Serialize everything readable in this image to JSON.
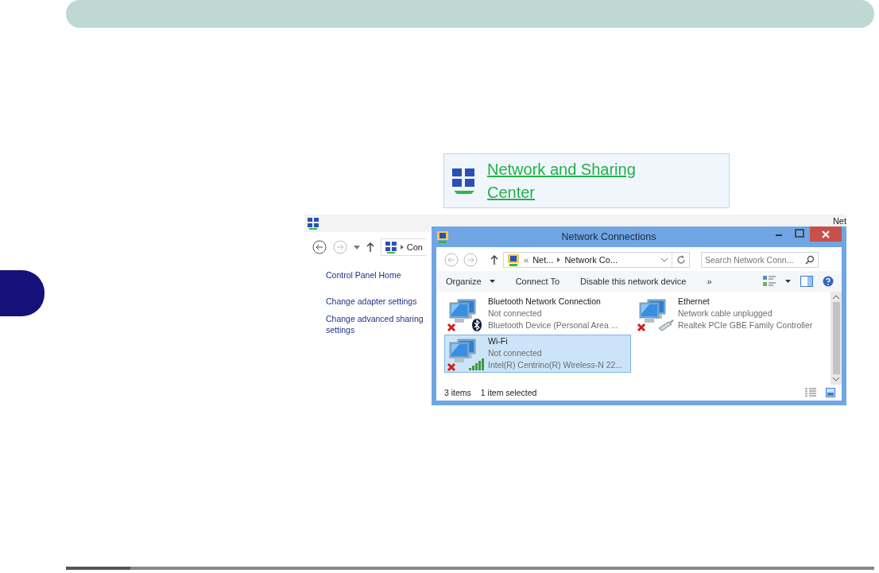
{
  "callout": {
    "link": "Network and Sharing Center"
  },
  "back_window": {
    "title": "Net",
    "address": "Con",
    "sidebar": [
      {
        "label": "Control Panel Home",
        "kind": "home"
      },
      {
        "label": "Change adapter settings",
        "kind": "link"
      },
      {
        "label": "Change advanced sharing settings",
        "kind": "link"
      }
    ]
  },
  "front_window": {
    "title": "Network Connections",
    "breadcrumb_prefix": "«",
    "breadcrumb": [
      "Net...",
      "Network Co..."
    ],
    "search": {
      "placeholder": "Search Network Conn..."
    },
    "toolbar": [
      {
        "label": "Organize",
        "dropdown": true
      },
      {
        "label": "Connect To",
        "dropdown": false
      },
      {
        "label": "Disable this network device",
        "dropdown": false
      }
    ],
    "more": "»",
    "items": [
      {
        "name": "Bluetooth Network Connection",
        "status": "Not connected",
        "device": "Bluetooth Device (Personal Area ...",
        "kind": "bluetooth",
        "selected": false
      },
      {
        "name": "Ethernet",
        "status": "Network cable unplugged",
        "device": "Realtek PCIe GBE Family Controller",
        "kind": "ethernet",
        "selected": false
      },
      {
        "name": "Wi-Fi",
        "status": "Not connected",
        "device": "Intel(R) Centrino(R) Wireless-N 22...",
        "kind": "wifi",
        "selected": true
      }
    ],
    "status_bar": {
      "count": "3 items",
      "selection": "1 item selected"
    }
  }
}
